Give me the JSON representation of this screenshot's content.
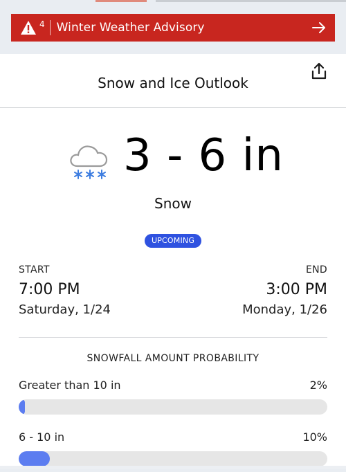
{
  "alert": {
    "count": "4",
    "label": "Winter Weather Advisory",
    "icon": "warning-triangle-icon",
    "arrow_icon": "arrow-right-icon",
    "color": "#c8261f"
  },
  "card": {
    "title": "Snow and Ice Outlook",
    "share_icon": "share-icon"
  },
  "forecast": {
    "amount": "3 - 6 in",
    "precip_type": "Snow",
    "icon": "cloud-snow-icon",
    "status": "UPCOMING",
    "status_color": "#2f52e0"
  },
  "timing": {
    "start_label": "START",
    "start_time": "7:00 PM",
    "start_date": "Saturday, 1/24",
    "end_label": "END",
    "end_time": "3:00 PM",
    "end_date": "Monday, 1/26"
  },
  "probability": {
    "title": "SNOWFALL AMOUNT PROBABILITY",
    "bar_color": "#5c7df0",
    "rows": [
      {
        "label": "Greater than 10 in",
        "value": "2%",
        "fraction": 0.02
      },
      {
        "label": "6 - 10 in",
        "value": "10%",
        "fraction": 0.1
      }
    ]
  }
}
